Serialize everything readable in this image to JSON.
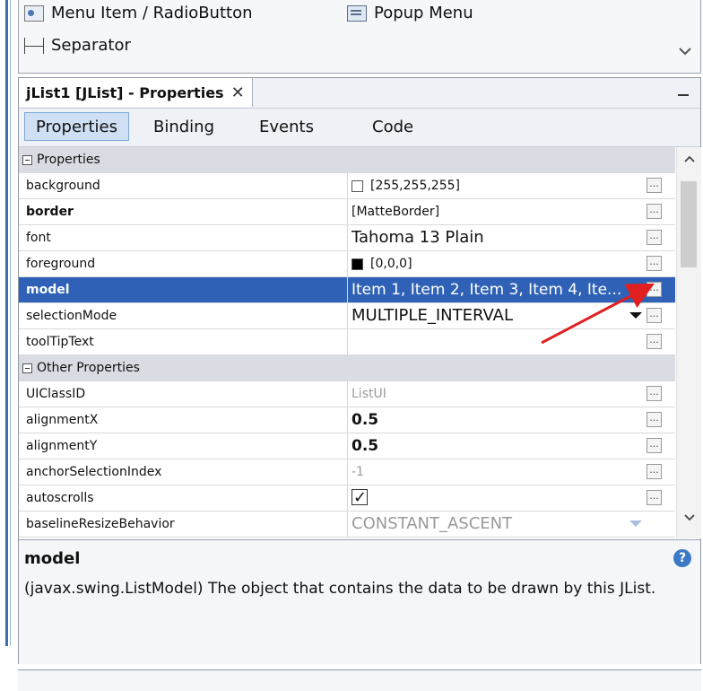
{
  "palette": {
    "items": [
      {
        "label": "Menu Item / RadioButton",
        "icon": "radio-menu-icon"
      },
      {
        "label": "Popup Menu",
        "icon": "popup-menu-icon"
      },
      {
        "label": "Separator",
        "icon": "separator-icon"
      }
    ]
  },
  "panel": {
    "title": "jList1 [JList] - Properties",
    "tabs": [
      "Properties",
      "Binding",
      "Events",
      "Code"
    ],
    "active_tab": "Properties"
  },
  "sections": {
    "properties": "Properties",
    "other": "Other Properties"
  },
  "rows": [
    {
      "name": "background",
      "value": "[255,255,255]"
    },
    {
      "name": "border",
      "value": "[MatteBorder]"
    },
    {
      "name": "font",
      "value": "Tahoma 13 Plain"
    },
    {
      "name": "foreground",
      "value": "[0,0,0]"
    },
    {
      "name": "model",
      "value": "Item 1, Item 2, Item 3, Item 4, Ite..."
    },
    {
      "name": "selectionMode",
      "value": "MULTIPLE_INTERVAL"
    },
    {
      "name": "toolTipText",
      "value": ""
    },
    {
      "name": "UIClassID",
      "value": "ListUI"
    },
    {
      "name": "alignmentX",
      "value": "0.5"
    },
    {
      "name": "alignmentY",
      "value": "0.5"
    },
    {
      "name": "anchorSelectionIndex",
      "value": "-1"
    },
    {
      "name": "autoscrolls",
      "value": ""
    },
    {
      "name": "baselineResizeBehavior",
      "value": "CONSTANT_ASCENT"
    }
  ],
  "ellipsis": "...",
  "description": {
    "title": "model",
    "text": "(javax.swing.ListModel) The object that contains the data to be drawn by this JList."
  },
  "colors": {
    "selection": "#2f62b6",
    "annotation_arrow": "#e02020"
  },
  "icons": {
    "close": "close-icon",
    "minimize": "minimize-icon",
    "help": "help-icon"
  }
}
